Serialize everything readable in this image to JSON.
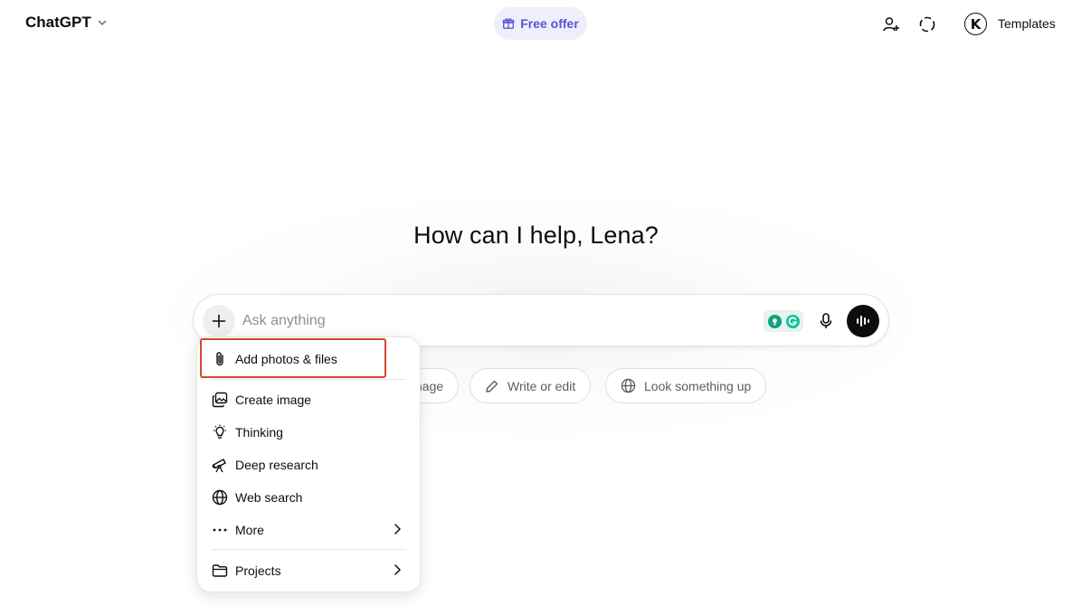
{
  "header": {
    "brand": "ChatGPT",
    "free_offer": "Free offer",
    "avatar_initial": "K",
    "templates": "Templates"
  },
  "main": {
    "greeting": "How can I help, Lena?",
    "composer": {
      "placeholder": "Ask anything"
    },
    "chips": [
      {
        "label": "nage",
        "icon": "image-icon"
      },
      {
        "label": "Write or edit",
        "icon": "pencil-icon"
      },
      {
        "label": "Look something up",
        "icon": "globe-icon"
      }
    ]
  },
  "attach_menu": {
    "items": [
      {
        "label": "Add photos & files",
        "icon": "paperclip-icon"
      },
      {
        "label": "Create image",
        "icon": "image-icon"
      },
      {
        "label": "Thinking",
        "icon": "lightbulb-icon"
      },
      {
        "label": "Deep research",
        "icon": "telescope-icon"
      },
      {
        "label": "Web search",
        "icon": "globe-icon"
      },
      {
        "label": "More",
        "icon": "more-dots-icon"
      },
      {
        "label": "Projects",
        "icon": "folder-icon"
      }
    ]
  },
  "colors": {
    "highlight": "#d9442f",
    "free_offer_text": "#5b52d6",
    "free_offer_bg": "#eeeefc"
  }
}
